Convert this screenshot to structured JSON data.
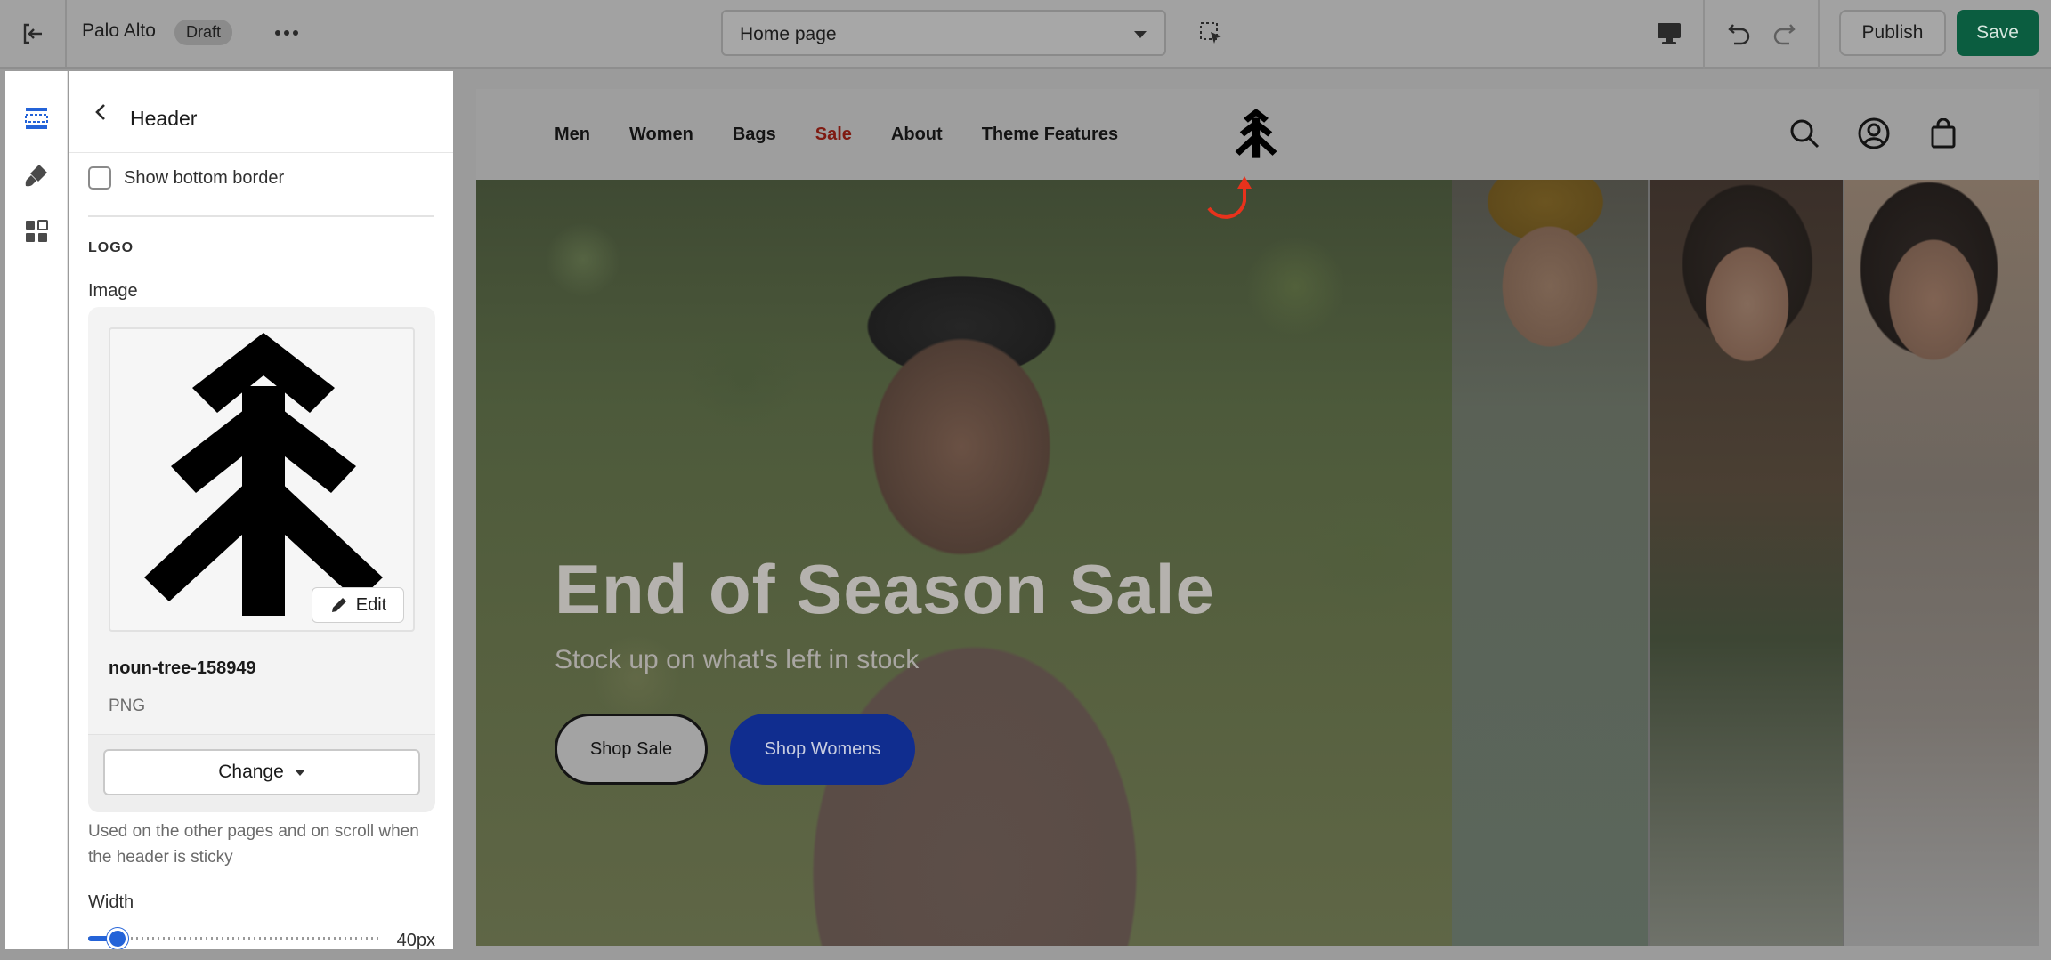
{
  "topbar": {
    "store_name": "Palo Alto",
    "status_badge": "Draft",
    "page_selector": "Home page",
    "publish_label": "Publish",
    "save_label": "Save"
  },
  "panel": {
    "title": "Header",
    "show_bottom_border_label": "Show bottom border",
    "show_bottom_border_checked": false,
    "section_logo": "LOGO",
    "image_label": "Image",
    "edit_label": "Edit",
    "file_name": "noun-tree-158949",
    "file_type": "PNG",
    "change_label": "Change",
    "help_text": "Used on the other pages and on scroll when the header is sticky",
    "width_label": "Width",
    "width_value": "40px",
    "width_fraction": 0.07
  },
  "preview": {
    "nav": [
      "Men",
      "Women",
      "Bags",
      "Sale",
      "About",
      "Theme Features"
    ],
    "hero_title": "End of Season Sale",
    "hero_subtitle": "Stock up on what's left in stock",
    "button_sale": "Shop Sale",
    "button_womens": "Shop Womens"
  },
  "colors": {
    "save_green": "#0b5d40",
    "accent_blue": "#2463d8",
    "sale_red": "#7f1b12",
    "womens_button": "#102d8f",
    "annotation_red": "#e8321c"
  },
  "icons": {
    "exit": "exit-icon",
    "more": "more-horizontal-icon",
    "inspector": "select-cursor-icon",
    "device": "desktop-icon",
    "undo": "undo-icon",
    "redo": "redo-icon",
    "sections": "sections-icon",
    "theme_settings": "paint-brush-icon",
    "apps": "apps-icon",
    "back": "chevron-left-icon",
    "search": "search-icon",
    "account": "account-icon",
    "cart": "shopping-bag-icon",
    "logo": "tree-logo-icon"
  }
}
